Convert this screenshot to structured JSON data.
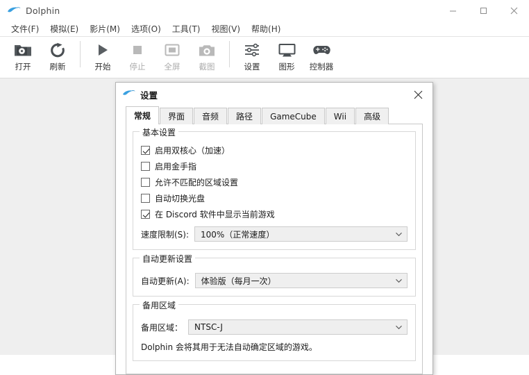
{
  "window": {
    "title": "Dolphin",
    "logo_icon": "dolphin-logo-icon",
    "controls": {
      "minimize": "minimize-icon",
      "maximize": "maximize-icon",
      "close": "close-icon"
    }
  },
  "menubar": {
    "items": [
      {
        "label": "文件(F)"
      },
      {
        "label": "模拟(E)"
      },
      {
        "label": "影片(M)"
      },
      {
        "label": "选项(O)"
      },
      {
        "label": "工具(T)"
      },
      {
        "label": "视图(V)"
      },
      {
        "label": "帮助(H)"
      }
    ]
  },
  "toolbar": {
    "buttons": [
      {
        "label": "打开",
        "icon": "open-disc-folder-icon",
        "enabled": true
      },
      {
        "label": "刷新",
        "icon": "refresh-icon",
        "enabled": true
      },
      {
        "label": "开始",
        "icon": "play-icon",
        "enabled": true
      },
      {
        "label": "停止",
        "icon": "stop-icon",
        "enabled": false
      },
      {
        "label": "全屏",
        "icon": "fullscreen-icon",
        "enabled": false
      },
      {
        "label": "截图",
        "icon": "screenshot-camera-icon",
        "enabled": false
      },
      {
        "label": "设置",
        "icon": "sliders-settings-icon",
        "enabled": true
      },
      {
        "label": "图形",
        "icon": "monitor-graphics-icon",
        "enabled": true
      },
      {
        "label": "控制器",
        "icon": "gamepad-controller-icon",
        "enabled": true
      }
    ]
  },
  "dialog": {
    "title": "设置",
    "logo_icon": "dolphin-logo-icon",
    "close_icon": "close-icon",
    "tabs": [
      {
        "label": "常规",
        "active": true
      },
      {
        "label": "界面",
        "active": false
      },
      {
        "label": "音频",
        "active": false
      },
      {
        "label": "路径",
        "active": false
      },
      {
        "label": "GameCube",
        "active": false
      },
      {
        "label": "Wii",
        "active": false
      },
      {
        "label": "高级",
        "active": false
      }
    ],
    "groups": {
      "basic": {
        "title": "基本设置",
        "checkboxes": [
          {
            "label": "启用双核心（加速）",
            "checked": true
          },
          {
            "label": "启用金手指",
            "checked": false
          },
          {
            "label": "允许不匹配的区域设置",
            "checked": false
          },
          {
            "label": "自动切换光盘",
            "checked": false
          },
          {
            "label": "在 Discord 软件中显示当前游戏",
            "checked": true
          }
        ],
        "speed_limit": {
          "label": "速度限制(S):",
          "value": "100%（正常速度）",
          "arrow_icon": "chevron-down-icon"
        }
      },
      "auto_update": {
        "title": "自动更新设置",
        "update_track": {
          "label": "自动更新(A):",
          "value": "体验版（每月一次）",
          "arrow_icon": "chevron-down-icon"
        }
      },
      "fallback_region": {
        "title": "备用区域",
        "region": {
          "label": "备用区域：",
          "value": "NTSC-J",
          "arrow_icon": "chevron-down-icon"
        },
        "help_text": "Dolphin 会将其用于无法自动确定区域的游戏。"
      }
    }
  },
  "colors": {
    "window_bg": "#efefef",
    "chrome_bg": "#ffffff",
    "accent_logo": "#3aa0e0",
    "border": "#c8c8c8",
    "field_bg": "#efefef"
  }
}
